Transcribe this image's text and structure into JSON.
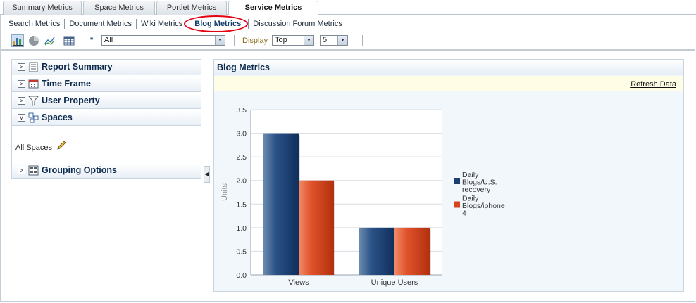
{
  "top_tabs": [
    {
      "label": "Summary Metrics"
    },
    {
      "label": "Space Metrics"
    },
    {
      "label": "Portlet Metrics"
    },
    {
      "label": "Service Metrics"
    }
  ],
  "sub_tabs": [
    {
      "label": "Search Metrics"
    },
    {
      "label": "Document Metrics"
    },
    {
      "label": "Wiki Metrics"
    },
    {
      "label": "Blog Metrics"
    },
    {
      "label": "Discussion Forum Metrics"
    }
  ],
  "toolbar": {
    "asterisk": "*",
    "filter_value": "All",
    "display_label": "Display",
    "display_value": "Top",
    "count_value": "5"
  },
  "left_panel": {
    "sections": [
      {
        "title": "Report Summary",
        "state": "collapsed",
        "icon": "report-icon"
      },
      {
        "title": "Time Frame",
        "state": "collapsed",
        "icon": "calendar-icon"
      },
      {
        "title": "User Property",
        "state": "collapsed",
        "icon": "filter-icon"
      },
      {
        "title": "Spaces",
        "state": "expanded",
        "icon": "spaces-icon"
      },
      {
        "title": "Grouping Options",
        "state": "collapsed",
        "icon": "grouping-icon"
      }
    ],
    "spaces_value": "All Spaces"
  },
  "right_panel": {
    "title": "Blog Metrics",
    "refresh_label": "Refresh Data"
  },
  "colors": {
    "series_blue": "#1b3f6e",
    "series_orange": "#d5441c",
    "accent": "#0d2a4d"
  },
  "chart_data": {
    "type": "bar",
    "categories": [
      "Views",
      "Unique Users"
    ],
    "series": [
      {
        "name": "Daily Blogs/U.S. recovery",
        "values": [
          3.0,
          1.0
        ]
      },
      {
        "name": "Daily Blogs/iphone 4",
        "values": [
          2.0,
          1.0
        ]
      }
    ],
    "ylabel": "Units",
    "ylim": [
      0,
      3.5
    ],
    "yticks": [
      "0.0",
      "0.5",
      "1.0",
      "1.5",
      "2.0",
      "2.5",
      "3.0",
      "3.5"
    ],
    "legend_position": "right",
    "grid": true
  }
}
